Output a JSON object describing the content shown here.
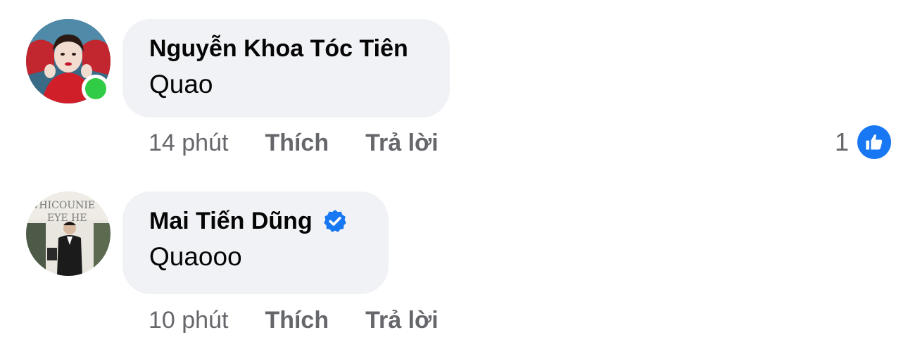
{
  "comments": [
    {
      "author": "Nguyễn Khoa Tóc Tiên",
      "text": "Quao",
      "time": "14 phút",
      "like_label": "Thích",
      "reply_label": "Trả lời",
      "online": true,
      "verified": false,
      "reaction_count": "1"
    },
    {
      "author": "Mai Tiến Dũng",
      "text": "Quaooo",
      "time": "10 phút",
      "like_label": "Thích",
      "reply_label": "Trả lời",
      "online": false,
      "verified": true
    }
  ],
  "colors": {
    "bubble": "#f0f2f5",
    "meta_text": "#65676b",
    "primary_text": "#050505",
    "accent_blue": "#1877f2",
    "online_green": "#31cc46"
  },
  "icons": {
    "verified": "verified-badge-icon",
    "like": "thumbs-up-icon",
    "online": "online-status-icon"
  }
}
